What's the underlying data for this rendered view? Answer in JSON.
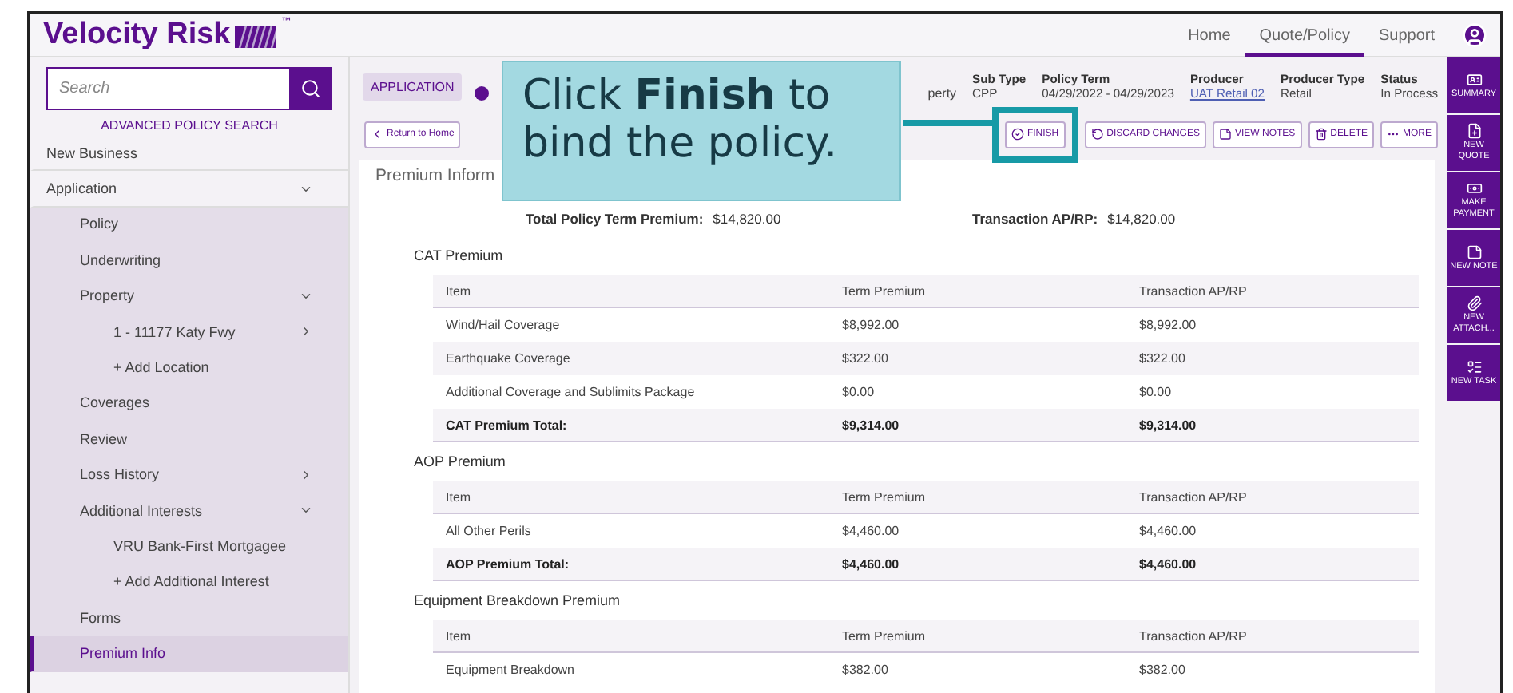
{
  "header": {
    "logo": "Velocity Risk",
    "trademark": "™",
    "nav": [
      {
        "label": "Home",
        "selected": false
      },
      {
        "label": "Quote/Policy",
        "selected": true
      },
      {
        "label": "Support",
        "selected": false
      }
    ]
  },
  "sidebar": {
    "search": {
      "placeholder": "Search"
    },
    "advanced_link": "ADVANCED POLICY SEARCH",
    "items": [
      {
        "label": "New Business",
        "selected": false
      },
      {
        "label": "Application",
        "selected": false,
        "expanded": true,
        "children": [
          {
            "label": "Policy",
            "selected": false
          },
          {
            "label": "Underwriting",
            "selected": false
          },
          {
            "label": "Property",
            "selected": false,
            "expanded": true,
            "children": [
              {
                "label": "1 - 11177 Katy Fwy",
                "selected": false,
                "expanded": false
              },
              {
                "label": "+ Add Location",
                "selected": false
              }
            ]
          },
          {
            "label": "Coverages",
            "selected": false
          },
          {
            "label": "Review",
            "selected": false
          },
          {
            "label": "Loss History",
            "selected": false,
            "expanded": false
          },
          {
            "label": "Additional Interests",
            "selected": false,
            "expanded": true,
            "children": [
              {
                "label": "VRU Bank-First Mortgagee",
                "selected": false
              },
              {
                "label": "+ Add Additional Interest",
                "selected": false
              }
            ]
          },
          {
            "label": "Forms",
            "selected": false
          },
          {
            "label": "Premium Info",
            "selected": true
          }
        ]
      }
    ]
  },
  "info_bar": {
    "badge": "APPLICATION",
    "partial_value": "perty",
    "fields": [
      {
        "label": "Sub Type",
        "value": "CPP",
        "kind": "text"
      },
      {
        "label": "Policy Term",
        "value": "04/29/2022 - 04/29/2023",
        "kind": "text"
      },
      {
        "label": "Producer",
        "value": "UAT Retail 02",
        "kind": "link"
      },
      {
        "label": "Producer Type",
        "value": "Retail",
        "kind": "text"
      },
      {
        "label": "Status",
        "value": "In Process",
        "kind": "text"
      }
    ]
  },
  "actions": {
    "return": "Return to Home",
    "buttons": [
      {
        "label": "FINISH",
        "kind": "finish",
        "highlighted": true
      },
      {
        "label": "DISCARD CHANGES",
        "kind": "discard",
        "highlighted": false
      },
      {
        "label": "VIEW NOTES",
        "kind": "notes",
        "highlighted": false
      },
      {
        "label": "DELETE",
        "kind": "delete",
        "highlighted": false
      },
      {
        "label": "MORE",
        "kind": "more",
        "highlighted": false
      }
    ]
  },
  "callout": {
    "text": "Click **Finish** to bind the policy."
  },
  "premium": {
    "title": "Premium Inform",
    "totals": [
      {
        "label": "Total Policy Term Premium:",
        "value": "$14,820.00"
      },
      {
        "label": "Transaction AP/RP:",
        "value": "$14,820.00"
      }
    ],
    "sections": [
      {
        "title": "CAT Premium",
        "columns": [
          "Item",
          "Term Premium",
          "Transaction AP/RP"
        ],
        "rows": [
          {
            "kind": "item",
            "cells": [
              "Wind/Hail Coverage",
              "$8,992.00",
              "$8,992.00"
            ]
          },
          {
            "kind": "item",
            "cells": [
              "Earthquake Coverage",
              "$322.00",
              "$322.00"
            ]
          },
          {
            "kind": "item",
            "cells": [
              "Additional Coverage and Sublimits Package",
              "$0.00",
              "$0.00"
            ]
          },
          {
            "kind": "total",
            "cells": [
              "CAT Premium Total:",
              "$9,314.00",
              "$9,314.00"
            ]
          }
        ]
      },
      {
        "title": "AOP Premium",
        "columns": [
          "Item",
          "Term Premium",
          "Transaction AP/RP"
        ],
        "rows": [
          {
            "kind": "item",
            "cells": [
              "All Other Perils",
              "$4,460.00",
              "$4,460.00"
            ]
          },
          {
            "kind": "total",
            "cells": [
              "AOP Premium Total:",
              "$4,460.00",
              "$4,460.00"
            ]
          }
        ]
      },
      {
        "title": "Equipment Breakdown Premium",
        "columns": [
          "Item",
          "Term Premium",
          "Transaction AP/RP"
        ],
        "rows": [
          {
            "kind": "item",
            "cells": [
              "Equipment Breakdown",
              "$382.00",
              "$382.00"
            ]
          }
        ]
      }
    ]
  },
  "rail": [
    {
      "label": "SUMMARY",
      "kind": "summary"
    },
    {
      "label": "NEW QUOTE",
      "kind": "quote"
    },
    {
      "label": "MAKE PAYMENT",
      "kind": "payment"
    },
    {
      "label": "NEW NOTE",
      "kind": "note"
    },
    {
      "label": "NEW ATTACH...",
      "kind": "attach"
    },
    {
      "label": "NEW TASK",
      "kind": "task"
    }
  ]
}
